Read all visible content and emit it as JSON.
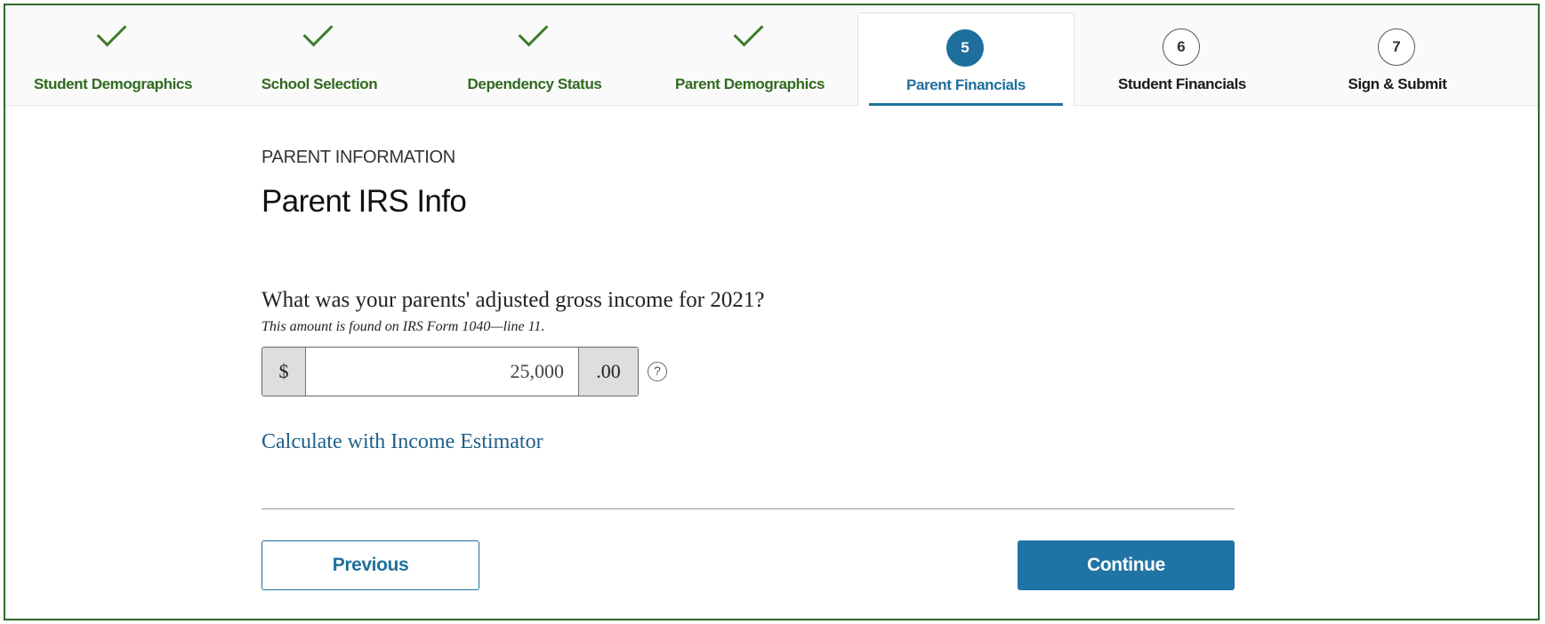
{
  "stepper": {
    "steps": [
      {
        "label": "Student Demographics",
        "state": "complete",
        "icon": "check-icon"
      },
      {
        "label": "School Selection",
        "state": "complete",
        "icon": "check-icon"
      },
      {
        "label": "Dependency Status",
        "state": "complete",
        "icon": "check-icon"
      },
      {
        "label": "Parent Demographics",
        "state": "complete",
        "icon": "check-icon"
      },
      {
        "label": "Parent Financials",
        "state": "current",
        "number": "5"
      },
      {
        "label": "Student Financials",
        "state": "upcoming",
        "number": "6"
      },
      {
        "label": "Sign & Submit",
        "state": "upcoming",
        "number": "7"
      }
    ]
  },
  "section": {
    "kicker": "PARENT INFORMATION",
    "title": "Parent IRS Info"
  },
  "question": {
    "text": "What was your parents' adjusted gross income for 2021?",
    "hint": "This amount is found on IRS Form 1040—line 11.",
    "currency_prefix": "$",
    "value": "25,000",
    "cents_suffix": ".00",
    "help_icon": "question-circle-icon"
  },
  "links": {
    "estimator": "Calculate with Income Estimator"
  },
  "actions": {
    "previous": "Previous",
    "continue": "Continue"
  },
  "colors": {
    "accent": "#1f74a5",
    "complete": "#3f7d2a",
    "frame": "#2e6a2e"
  }
}
